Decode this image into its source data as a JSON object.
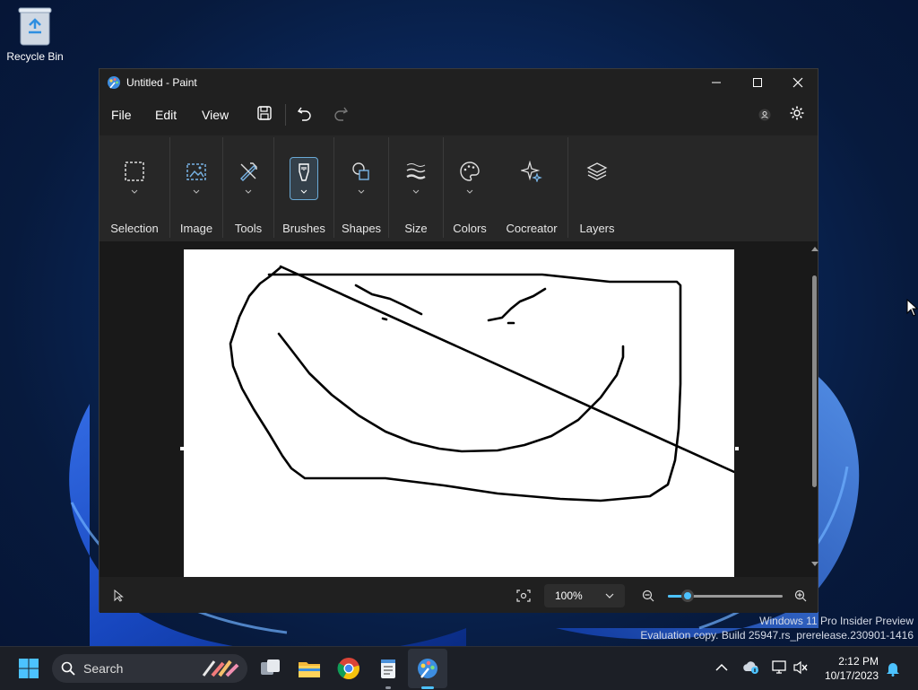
{
  "desktop": {
    "recycle_bin_label": "Recycle Bin",
    "watermark_line1": "Windows 11 Pro Insider Preview",
    "watermark_line2": "Evaluation copy. Build 25947.rs_prerelease.230901-1416"
  },
  "window": {
    "title": "Untitled - Paint",
    "controls": {
      "minimize": "minimize-icon",
      "maximize": "maximize-icon",
      "close": "close-icon"
    }
  },
  "menubar": {
    "items": [
      "File",
      "Edit",
      "View"
    ],
    "icons": [
      "save-icon",
      "undo-icon",
      "redo-icon",
      "account-icon",
      "settings-icon"
    ]
  },
  "ribbon": {
    "groups": [
      {
        "label": "Selection",
        "icon": "selection-icon"
      },
      {
        "label": "Image",
        "icon": "image-icon"
      },
      {
        "label": "Tools",
        "icon": "tools-icon"
      },
      {
        "label": "Brushes",
        "icon": "brush-icon"
      },
      {
        "label": "Shapes",
        "icon": "shapes-icon"
      },
      {
        "label": "Size",
        "icon": "size-icon"
      },
      {
        "label": "Colors",
        "icon": "palette-icon"
      },
      {
        "label": "Cocreator",
        "icon": "sparkle-icon"
      },
      {
        "label": "Layers",
        "icon": "layers-icon"
      }
    ],
    "selected": "Brushes"
  },
  "statusbar": {
    "zoom_level": "100%",
    "zoom_percent": 100,
    "slider_fraction": 0.17
  },
  "taskbar": {
    "search_label": "Search",
    "time": "2:12 PM",
    "date": "10/17/2023",
    "accent_color": "#4cc2ff"
  }
}
